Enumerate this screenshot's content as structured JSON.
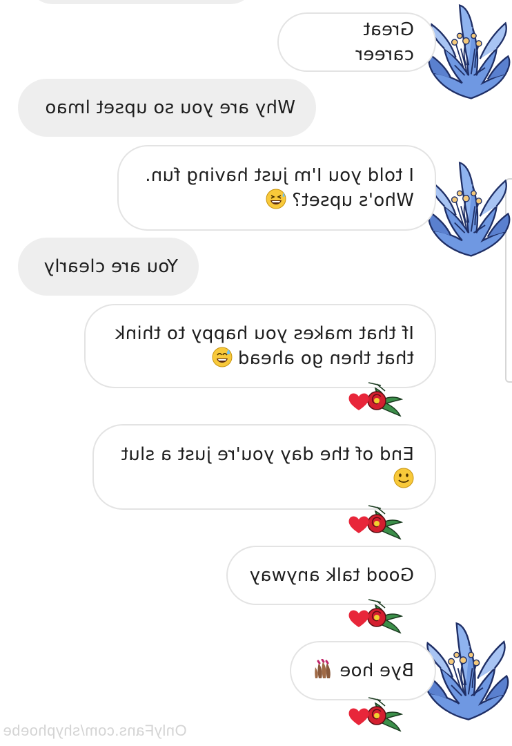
{
  "messages": {
    "great_career": "Great career",
    "why_upset": "Why are you so upset lmao",
    "told_you_line1": "I told you I'm just having fun.",
    "told_you_line2": "Who's upset?",
    "you_are_clearly": "You are clearly",
    "happy_line1": "If that makes you happy to think",
    "happy_line2": "that then go ahead",
    "slut_line1": "End of the day you're just a slut",
    "good_talk": "Good talk anyway",
    "bye": "Bye hoe"
  },
  "emojis": {
    "told_you": "grinning-squinting-face-with-sweat",
    "happy": "grinning-face-with-sweat",
    "slut": "slightly-smiling-face",
    "bye": "nail-polish"
  },
  "reactions": {
    "type": "heart-with-rose"
  },
  "watermark": "OnlyFans.com/shyphoebe",
  "colors": {
    "incoming_bubble": "#eeeeee",
    "outgoing_border": "#e3e3e3",
    "heart": "#e8263a",
    "lily": "#5f88d6"
  }
}
